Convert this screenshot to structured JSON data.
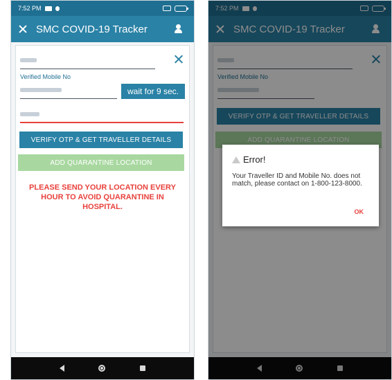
{
  "status": {
    "time": "7:52 PM"
  },
  "app_bar": {
    "title": "SMC COVID-19 Tracker"
  },
  "form": {
    "traveller_id_label": "",
    "mobile_label": "Verified Mobile No",
    "wait_button": "wait for 9 sec.",
    "verify_button": "VERIFY OTP & GET TRAVELLER DETAILS",
    "add_button": "ADD QUARANTINE LOCATION",
    "warning": "PLEASE SEND YOUR LOCATION EVERY HOUR TO AVOID QUARANTINE IN HOSPITAL."
  },
  "dialog": {
    "title": "Error!",
    "message": "Your Traveller ID and Mobile No. does not match, please contact on 1-800-123-8000.",
    "ok": "OK"
  },
  "colors": {
    "primary": "#2a82a6",
    "status_bar": "#1f6f92",
    "warning": "#e8413c",
    "add_button": "#a8d8a0"
  }
}
